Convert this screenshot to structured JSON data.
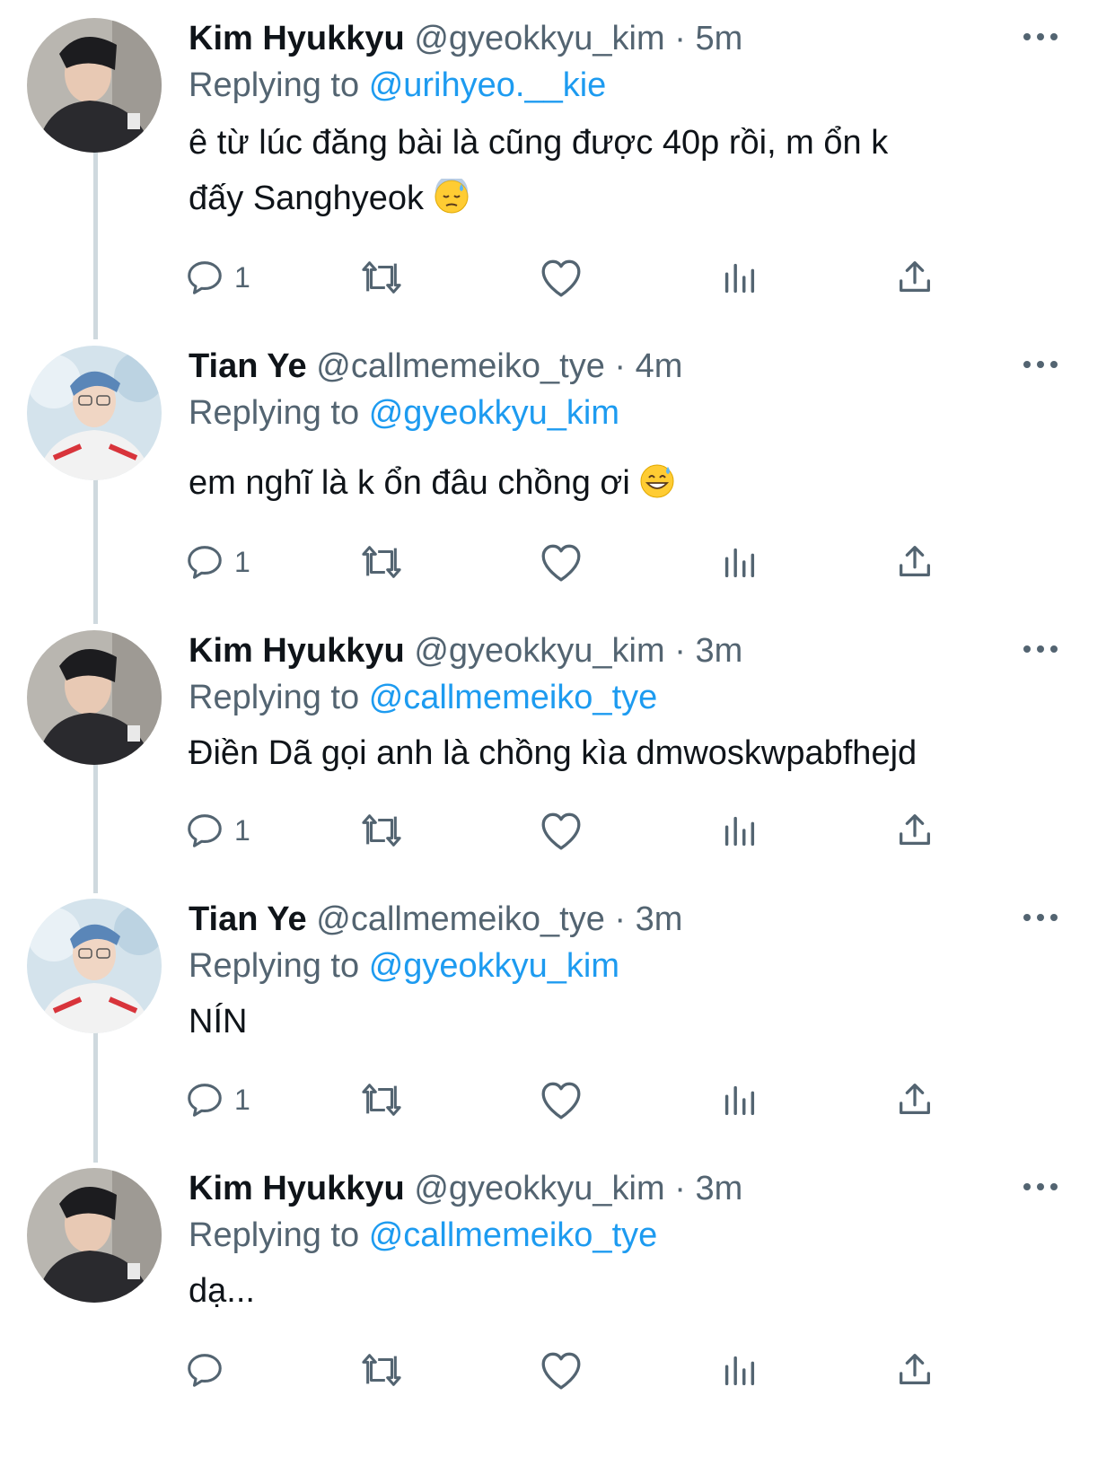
{
  "colors": {
    "link": "#1d9bf0",
    "secondary": "#536471",
    "text": "#0f1419",
    "thread_line": "#cfd9de"
  },
  "icons": [
    "reply-icon",
    "retweet-icon",
    "like-icon",
    "analytics-icon",
    "share-icon",
    "more-icon"
  ],
  "tweets": [
    {
      "name": "Kim Hyukkyu",
      "handle": "@gyeokkyu_kim",
      "sep": "·",
      "time": "5m",
      "replying_label": "Replying to",
      "replying_to": "@urihyeo.__kie",
      "text_line1": "ê từ lúc đăng bài là cũng được 40p rồi, m ổn k",
      "text_line2": "đấy Sanghyeok",
      "emoji": "downcast-face-with-sweat",
      "reply_count": "1"
    },
    {
      "name": "Tian Ye",
      "handle": "@callmemeiko_tye",
      "sep": "·",
      "time": "4m",
      "replying_label": "Replying to",
      "replying_to": "@gyeokkyu_kim",
      "text": "em nghĩ là k ổn đâu chồng ơi",
      "emoji": "grinning-face-with-sweat",
      "reply_count": "1"
    },
    {
      "name": "Kim Hyukkyu",
      "handle": "@gyeokkyu_kim",
      "sep": "·",
      "time": "3m",
      "replying_label": "Replying to",
      "replying_to": "@callmemeiko_tye",
      "text": "Điền Dã gọi anh là chồng kìa dmwoskwpabfhejd",
      "reply_count": "1"
    },
    {
      "name": "Tian Ye",
      "handle": "@callmemeiko_tye",
      "sep": "·",
      "time": "3m",
      "replying_label": "Replying to",
      "replying_to": "@gyeokkyu_kim",
      "text": "NÍN",
      "reply_count": "1"
    },
    {
      "name": "Kim Hyukkyu",
      "handle": "@gyeokkyu_kim",
      "sep": "·",
      "time": "3m",
      "replying_label": "Replying to",
      "replying_to": "@callmemeiko_tye",
      "text": "dạ...",
      "reply_count": ""
    }
  ]
}
